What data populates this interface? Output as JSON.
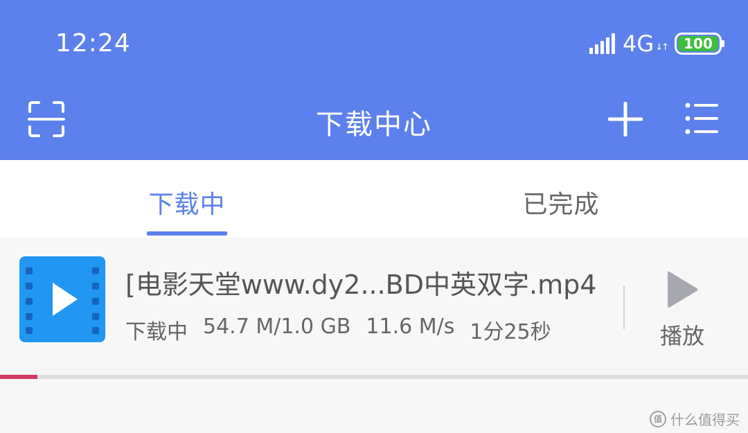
{
  "status_bar": {
    "time": "12:24",
    "network": "4G",
    "network_arrows": "↓↑",
    "battery": "100"
  },
  "header": {
    "title": "下载中心",
    "left_icon": "scan-icon",
    "right_icons": [
      "plus-icon",
      "menu-icon"
    ]
  },
  "tabs": [
    {
      "label": "下载中",
      "active": true
    },
    {
      "label": "已完成",
      "active": false
    }
  ],
  "download": {
    "file_name": "[电影天堂www.dy2...BD中英双字.mp4",
    "status": "下载中",
    "size": "54.7 M/1.0 GB",
    "speed": "11.6 M/s",
    "time_left": "1分25秒",
    "progress": 0.05,
    "action_label": "播放"
  },
  "watermark": {
    "logo_text": "值",
    "text": "什么值得买"
  },
  "colors": {
    "header_bg": "#5d81ec",
    "accent": "#5d81ec",
    "progress": "#d23a61",
    "battery": "#3fbd3f",
    "file_icon": "#2196f3"
  }
}
